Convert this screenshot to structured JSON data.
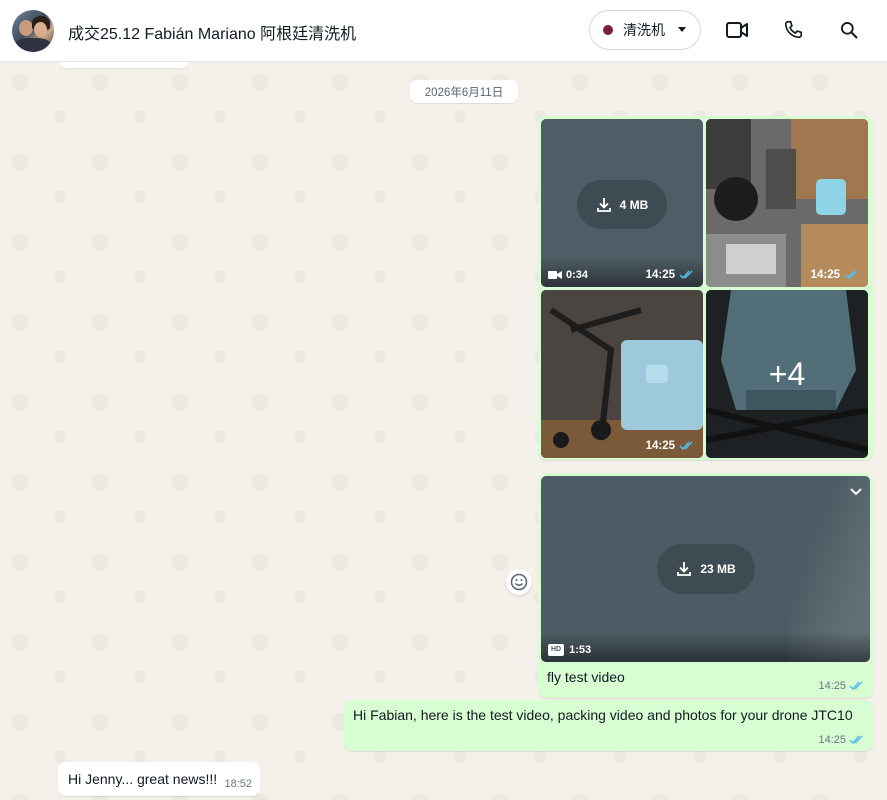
{
  "header": {
    "title": "成交25.12 Fabián Mariano 阿根廷清洗机",
    "label_tag": "清洗机",
    "label_color": "#7a1f3d",
    "icons": [
      "video-call-icon",
      "voice-call-icon",
      "search-icon"
    ]
  },
  "chat": {
    "date_chip": "2026年6月11日",
    "album": {
      "video_tile": {
        "download_size": "4 MB",
        "duration": "0:34",
        "time": "14:25"
      },
      "photo_tile_1": {
        "time": "14:25"
      },
      "photo_tile_2": {
        "time": "14:25"
      },
      "more_tile": {
        "more_count": "+4"
      }
    },
    "video_message": {
      "download_size": "23 MB",
      "quality_badge": "HD",
      "duration": "1:53",
      "caption": "fly test video",
      "time": "14:25"
    },
    "text_message_out": {
      "text": "Hi Fabian, here is the test video, packing video and photos for your drone JTC10",
      "time": "14:25"
    },
    "text_message_in": {
      "text": "Hi Jenny... great news!!!",
      "time": "18:52"
    }
  },
  "colors": {
    "outgoing_bubble": "#d9fdd3",
    "incoming_bubble": "#ffffff",
    "read_ticks": "#53bdeb"
  }
}
